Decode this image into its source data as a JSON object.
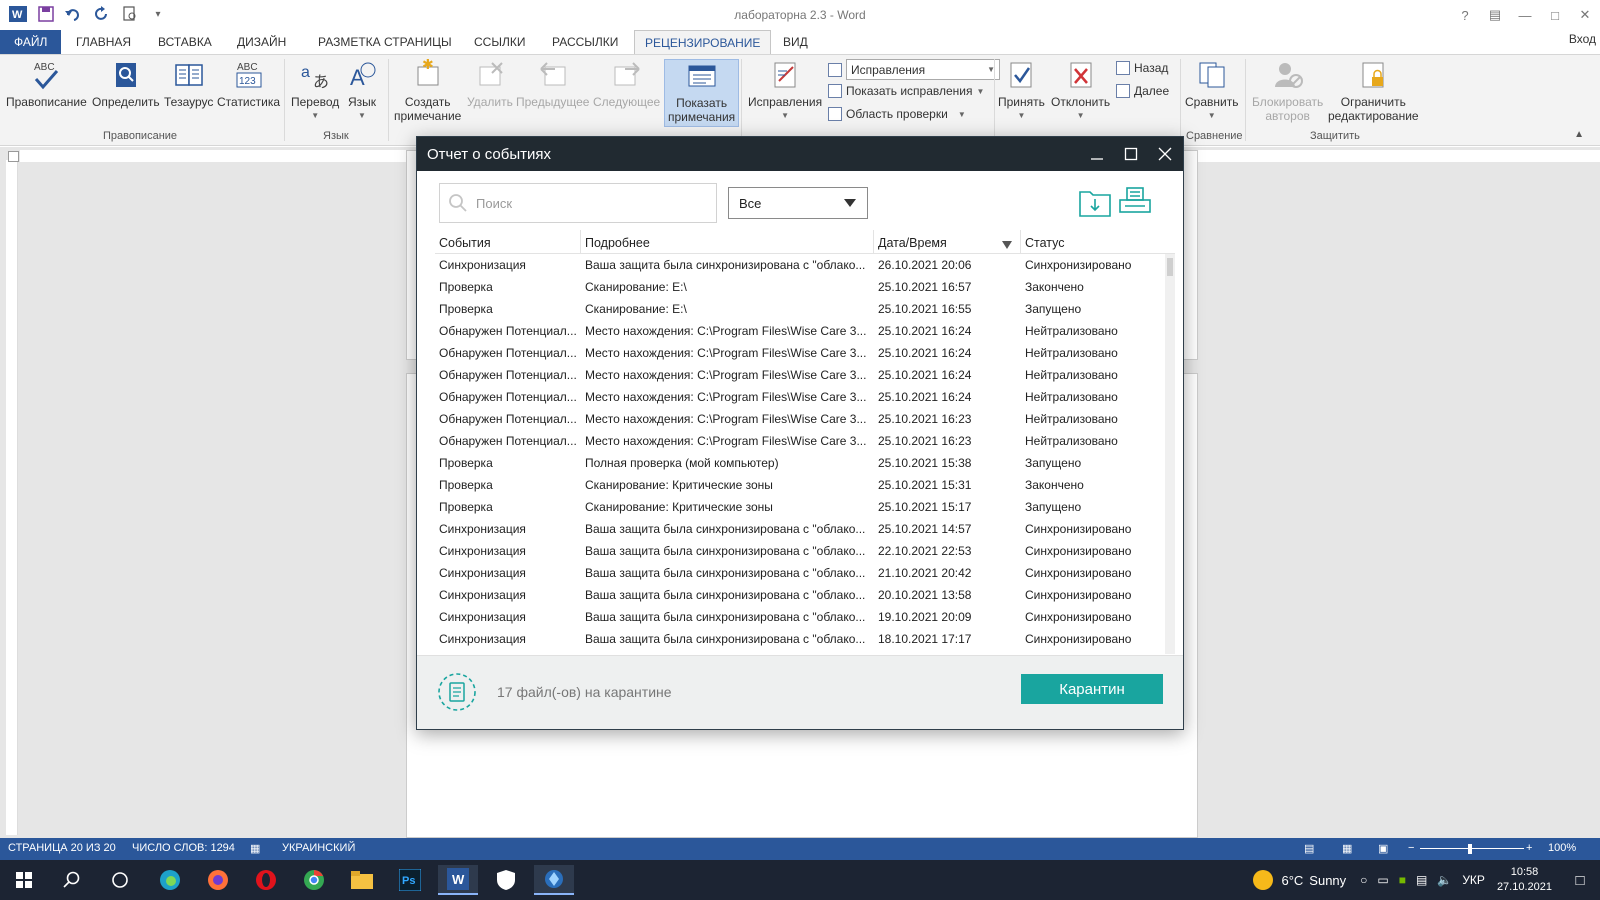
{
  "app": {
    "doc_title": "лабораторна 2.3 - Word",
    "signin": "Вход",
    "colors": {
      "word_blue": "#2b579a",
      "dialog_title_bg": "#212a31",
      "accent_teal": "#19a59f"
    }
  },
  "tabs": {
    "file": "ФАЙЛ",
    "home": "ГЛАВНАЯ",
    "insert": "ВСТАВКА",
    "design": "ДИЗАЙН",
    "layout": "РАЗМЕТКА СТРАНИЦЫ",
    "references": "ССЫЛКИ",
    "mailings": "РАССЫЛКИ",
    "review": "РЕЦЕНЗИРОВАНИЕ",
    "view": "ВИД"
  },
  "ribbon": {
    "spelling": "Правописание",
    "define": "Определить",
    "thesaurus": "Тезаурус",
    "stats": "Статистика",
    "group_proofing": "Правописание",
    "translate": "Перевод",
    "language": "Язык",
    "group_language": "Язык",
    "new_comment_1": "Создать",
    "new_comment_2": "примечание",
    "delete": "Удалить",
    "previous": "Предыдущее",
    "next": "Следующее",
    "show_comments_1": "Показать",
    "show_comments_2": "примечания",
    "tracking": "Исправления",
    "tracking_mode": "Исправления",
    "show_markup": "Показать исправления",
    "review_pane": "Область проверки",
    "accept": "Принять",
    "reject": "Отклонить",
    "back": "Назад",
    "forward": "Далее",
    "compare": "Сравнить",
    "group_compare": "Сравнение",
    "block_authors_1": "Блокировать",
    "block_authors_2": "авторов",
    "restrict_1": "Ограничить",
    "restrict_2": "редактирование",
    "group_protect": "Защитить"
  },
  "dialog": {
    "title": "Отчет о событиях",
    "search_placeholder": "Поиск",
    "filter_value": "Все",
    "columns": [
      "События",
      "Подробнее",
      "Дата/Время",
      "Статус"
    ],
    "rows": [
      [
        "Синхронизация",
        "Ваша защита была синхронизирована с \"облако...",
        "26.10.2021 20:06",
        "Синхронизировано"
      ],
      [
        "Проверка",
        "Сканирование: E:\\",
        "25.10.2021 16:57",
        "Закончено"
      ],
      [
        "Проверка",
        "Сканирование: E:\\",
        "25.10.2021 16:55",
        "Запущено"
      ],
      [
        "Обнаружен Потенциал...",
        "Место нахождения: C:\\Program Files\\Wise Care 3...",
        "25.10.2021 16:24",
        "Нейтрализовано"
      ],
      [
        "Обнаружен Потенциал...",
        "Место нахождения: C:\\Program Files\\Wise Care 3...",
        "25.10.2021 16:24",
        "Нейтрализовано"
      ],
      [
        "Обнаружен Потенциал...",
        "Место нахождения: C:\\Program Files\\Wise Care 3...",
        "25.10.2021 16:24",
        "Нейтрализовано"
      ],
      [
        "Обнаружен Потенциал...",
        "Место нахождения: C:\\Program Files\\Wise Care 3...",
        "25.10.2021 16:24",
        "Нейтрализовано"
      ],
      [
        "Обнаружен Потенциал...",
        "Место нахождения: C:\\Program Files\\Wise Care 3...",
        "25.10.2021 16:23",
        "Нейтрализовано"
      ],
      [
        "Обнаружен Потенциал...",
        "Место нахождения: C:\\Program Files\\Wise Care 3...",
        "25.10.2021 16:23",
        "Нейтрализовано"
      ],
      [
        "Проверка",
        "Полная проверка (мой компьютер)",
        "25.10.2021 15:38",
        "Запущено"
      ],
      [
        "Проверка",
        "Сканирование: Критические зоны",
        "25.10.2021 15:31",
        "Закончено"
      ],
      [
        "Проверка",
        "Сканирование: Критические зоны",
        "25.10.2021 15:17",
        "Запущено"
      ],
      [
        "Синхронизация",
        "Ваша защита была синхронизирована с \"облако...",
        "25.10.2021 14:57",
        "Синхронизировано"
      ],
      [
        "Синхронизация",
        "Ваша защита была синхронизирована с \"облако...",
        "22.10.2021 22:53",
        "Синхронизировано"
      ],
      [
        "Синхронизация",
        "Ваша защита была синхронизирована с \"облако...",
        "21.10.2021 20:42",
        "Синхронизировано"
      ],
      [
        "Синхронизация",
        "Ваша защита была синхронизирована с \"облако...",
        "20.10.2021 13:58",
        "Синхронизировано"
      ],
      [
        "Синхронизация",
        "Ваша защита была синхронизирована с \"облако...",
        "19.10.2021 20:09",
        "Синхронизировано"
      ],
      [
        "Синхронизация",
        "Ваша защита была синхронизирована с \"облако...",
        "18.10.2021 17:17",
        "Синхронизировано"
      ]
    ],
    "quarantine_count": "17 файл(-ов) на карантине",
    "quarantine_button": "Карантин"
  },
  "statusbar": {
    "page": "СТРАНИЦА 20 ИЗ 20",
    "words": "ЧИСЛО СЛОВ: 1294",
    "language": "УКРАИНСКИЙ",
    "zoom": "100%"
  },
  "taskbar": {
    "weather_temp": "6°C",
    "weather_desc": "Sunny",
    "lang": "УКР",
    "time": "10:58",
    "date": "27.10.2021"
  }
}
